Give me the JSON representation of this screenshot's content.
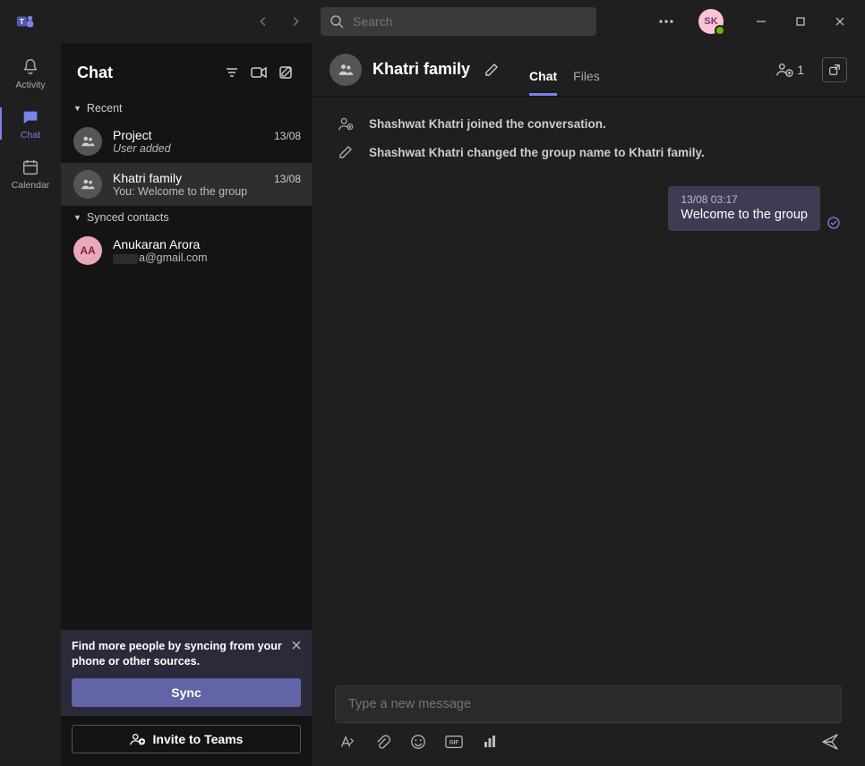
{
  "titlebar": {
    "search_placeholder": "Search",
    "avatar_initials": "SK"
  },
  "rail": {
    "items": [
      {
        "label": "Activity"
      },
      {
        "label": "Chat"
      },
      {
        "label": "Calendar"
      }
    ]
  },
  "chat_list": {
    "title": "Chat",
    "sections": {
      "recent_label": "Recent",
      "synced_label": "Synced contacts"
    },
    "recent": [
      {
        "name": "Project",
        "date": "13/08",
        "preview": "User added",
        "preview_italic": true
      },
      {
        "name": "Khatri family",
        "date": "13/08",
        "preview": "You: Welcome to the group",
        "preview_italic": false
      }
    ],
    "contacts": [
      {
        "name": "Anukaran Arora",
        "initials": "AA",
        "email_suffix": "a@gmail.com"
      }
    ],
    "sync_card_text": "Find more people by syncing from your phone or other sources.",
    "sync_button": "Sync",
    "invite_button": "Invite to Teams"
  },
  "conversation": {
    "title": "Khatri family",
    "tabs": {
      "chat": "Chat",
      "files": "Files"
    },
    "participant_count": "1",
    "system_messages": [
      "Shashwat Khatri joined the conversation.",
      "Shashwat Khatri changed the group name to Khatri family."
    ],
    "messages": [
      {
        "time": "13/08 03:17",
        "text": "Welcome to the group"
      }
    ],
    "composer_placeholder": "Type a new message"
  }
}
